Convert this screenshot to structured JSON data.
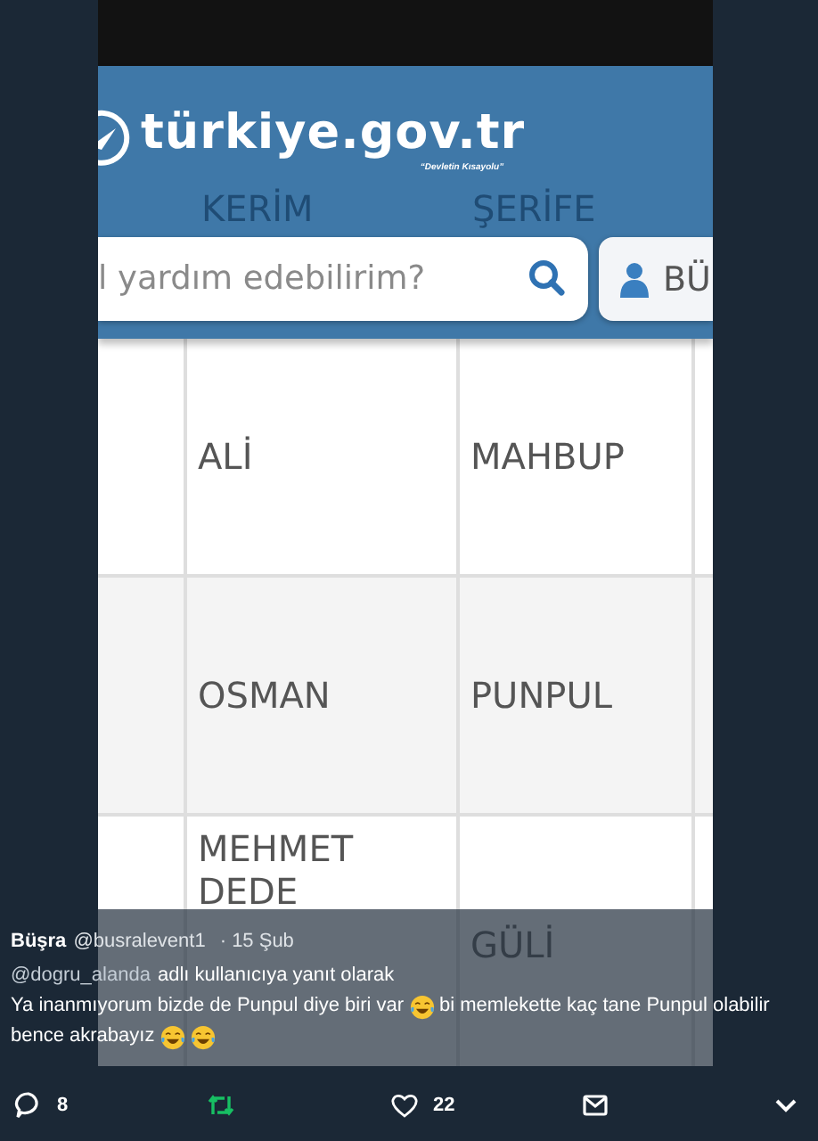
{
  "photo": {
    "logo": "türkiye.gov.tr",
    "tagline": "“Devletin Kısayolu”",
    "header_background_texts": [
      "KERİM",
      "ŞERİFE"
    ],
    "search": {
      "placeholder": "l yardım edebilirim?"
    },
    "login_button": "BÜ",
    "table": {
      "rows": [
        {
          "column_2": "ALİ",
          "column_3": "MAHBUP"
        },
        {
          "column_2": "OSMAN",
          "column_3": "PUNPUL"
        },
        {
          "column_2": "MEHMET DEDE",
          "column_3": "GÜLİ"
        }
      ]
    }
  },
  "tweet": {
    "author": "Büşra",
    "handle": "@busralevent1",
    "time": "· 15 Şub",
    "reply_to": "@dogru_alanda",
    "reply_note": "adlı kullanıcıya yanıt olarak",
    "body": [
      {
        "kind": "text",
        "text": "Ya inanmıyorum bizde de Punpul diye biri var"
      },
      {
        "kind": "emoji"
      },
      {
        "kind": "text",
        "text": "bi memlekette kaç tane Punpul olabilir"
      },
      {
        "kind": "break"
      },
      {
        "kind": "text",
        "text": "bence akrabayız"
      },
      {
        "kind": "emoji"
      },
      {
        "kind": "emoji"
      }
    ]
  },
  "actions": {
    "replies": "8",
    "retweeted": true,
    "likes": "22",
    "liked": false
  }
}
